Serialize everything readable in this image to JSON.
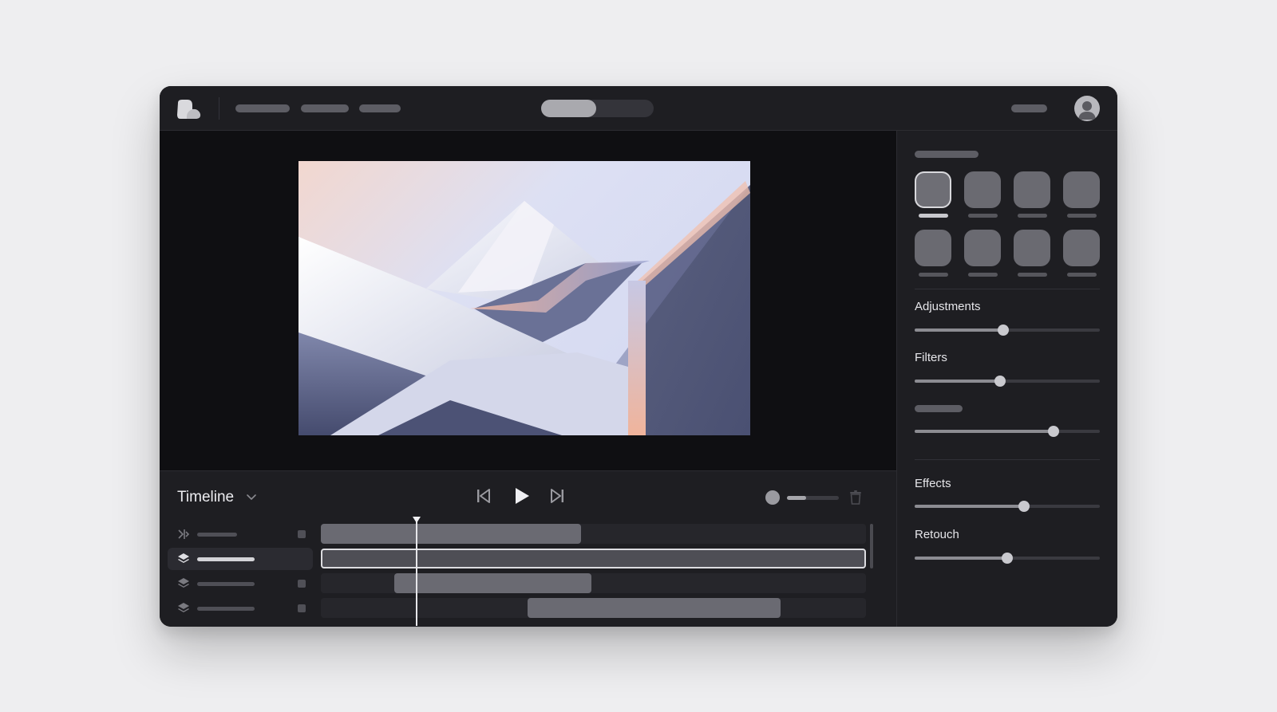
{
  "window": {
    "accent": "#c9c9ce",
    "background": "#1c1c20"
  },
  "topbar": {
    "logo_icon": "app-logo-icon",
    "segmented_toggle_active_index": 0,
    "avatar_icon": "user-avatar-icon"
  },
  "preview": {
    "image_description_icon": "canvas-image"
  },
  "panel": {
    "presets_selected_index": 0,
    "sliders": [
      {
        "label": "Adjustments",
        "value": 0.48
      },
      {
        "label": "Filters",
        "value": 0.46
      },
      {
        "label": "",
        "value": 0.75
      },
      {
        "label": "Effects",
        "value": 0.59
      },
      {
        "label": "Retouch",
        "value": 0.5
      }
    ]
  },
  "timeline": {
    "title": "Timeline",
    "controls": [
      "skip-back-icon",
      "play-icon",
      "skip-forward-icon",
      "record-icon",
      "trash-icon"
    ],
    "volume_level": 0.37,
    "selected_track_index": 1,
    "playhead_position": 0.18
  }
}
